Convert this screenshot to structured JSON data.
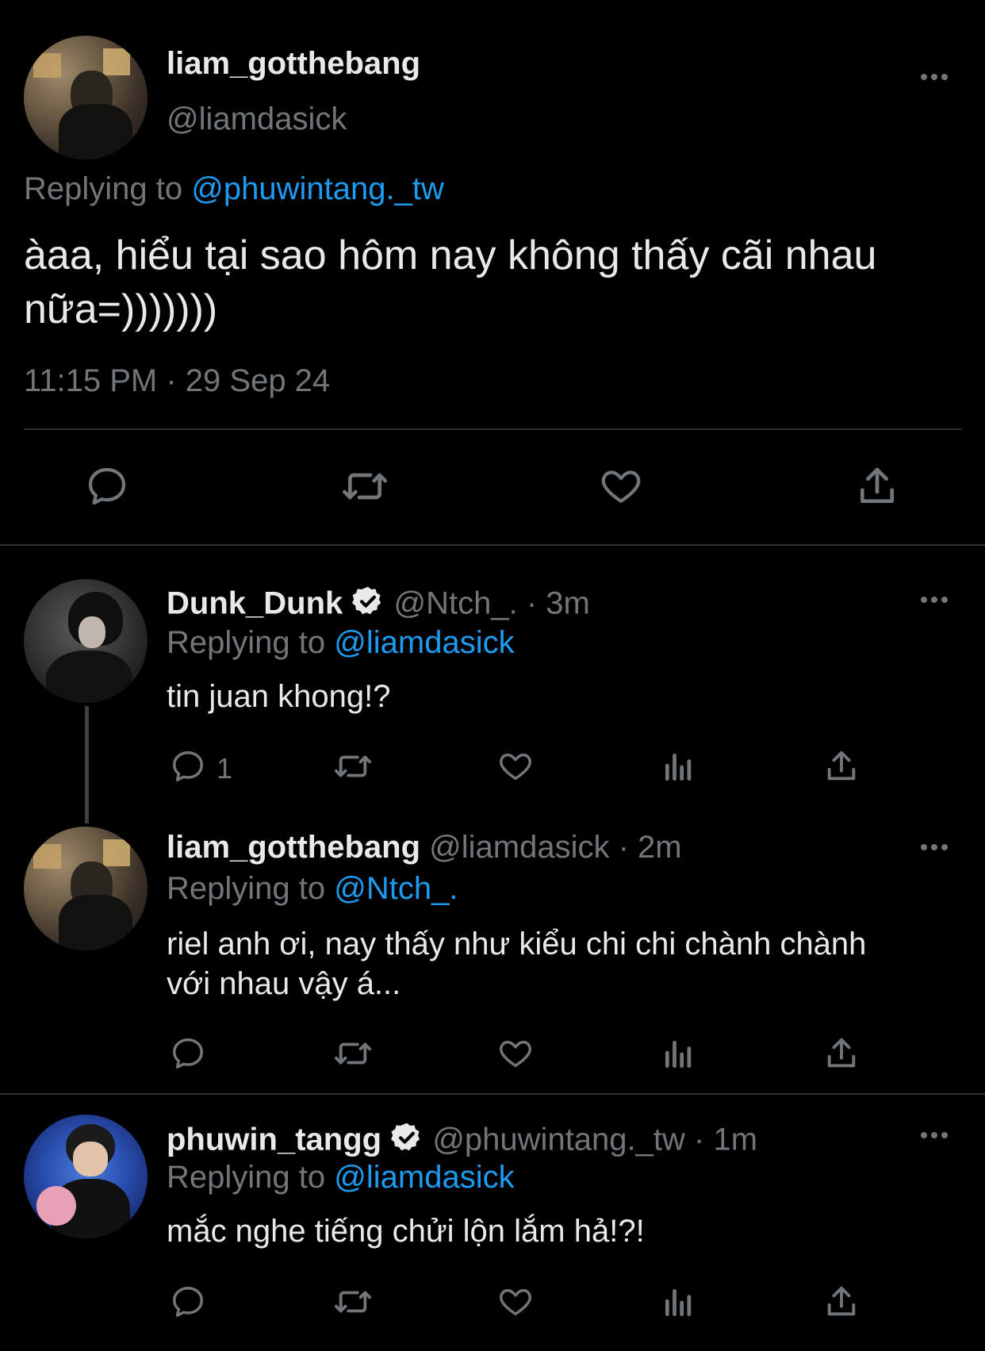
{
  "main_tweet": {
    "display_name": "liam_gotthebang",
    "handle": "@liamdasick",
    "replying_prefix": "Replying to",
    "replying_to": "@phuwintang._tw",
    "text_line1": "àaa, hiểu tại sao hôm nay không thấy cãi nhau",
    "text_line2": "nữa=)))))))",
    "timestamp": "11:15 PM · 29 Sep 24"
  },
  "replies": [
    {
      "display_name": "Dunk_Dunk",
      "handle": "@Ntch_.",
      "time": "· 3m",
      "verified": true,
      "replying_prefix": "Replying to",
      "replying_to": "@liamdasick",
      "text_line1": "tin juan khong!?",
      "text_line2": "",
      "reply_count": "1"
    },
    {
      "display_name": "liam_gotthebang",
      "handle": "@liamdasick",
      "time": "· 2m",
      "verified": false,
      "replying_prefix": "Replying to",
      "replying_to": "@Ntch_.",
      "text_line1": "riel anh ơi, nay thấy như kiểu chi chi chành chành",
      "text_line2": "với nhau vậy á...",
      "reply_count": ""
    },
    {
      "display_name": "phuwin_tangg",
      "handle": "@phuwintang._tw",
      "time": "· 1m",
      "verified": true,
      "replying_prefix": "Replying to",
      "replying_to": "@liamdasick",
      "text_line1": "mắc nghe tiếng chửi lộn lắm hả!?!",
      "text_line2": "",
      "reply_count": ""
    }
  ],
  "colors": {
    "background": "#000000",
    "text": "#e7e9ea",
    "muted": "#71767b",
    "link": "#1d9bf0",
    "divider": "#2f3336"
  },
  "icons": [
    "reply-icon",
    "retweet-icon",
    "like-icon",
    "share-icon",
    "views-icon",
    "more-icon",
    "verified-badge-icon"
  ]
}
